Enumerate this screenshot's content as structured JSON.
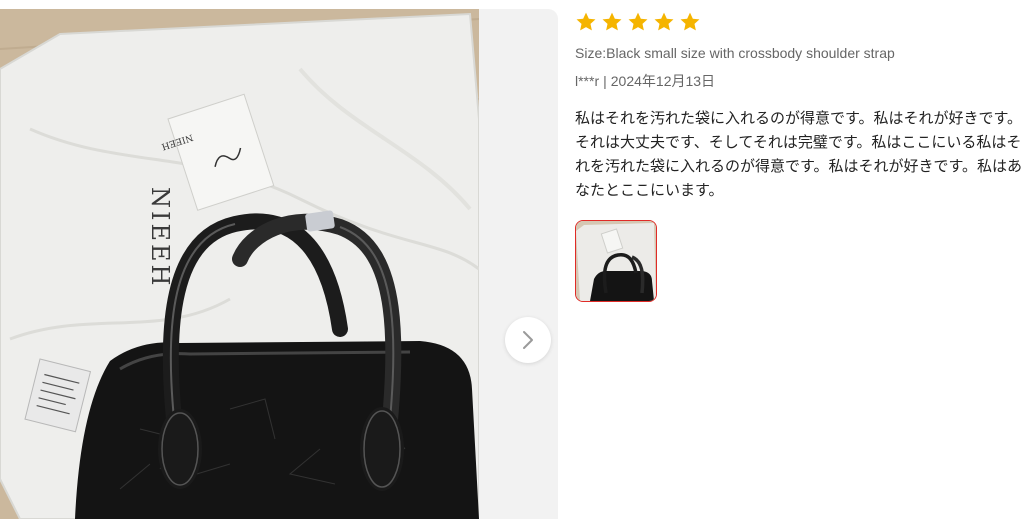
{
  "review": {
    "rating": 5,
    "star_color": "#f5b400",
    "sku": "Size:Black small size with crossbody shoulder strap",
    "author": "l***r",
    "separator": "|",
    "date": "2024年12月13日",
    "text": "私はそれを汚れた袋に入れるのが得意です。私はそれが好きです。それは大丈夫です、そしてそれは完璧です。私はここにいる私はそれを汚れた袋に入れるのが得意です。私はそれが好きです。私はあなたとここにいます。"
  },
  "gallery": {
    "next_icon": "chevron-right-icon",
    "thumbnail_selected_border": "#e02b27"
  },
  "photo": {
    "tag_brand_text": "NIEEH",
    "bag_brand_text": "NIEEH"
  }
}
